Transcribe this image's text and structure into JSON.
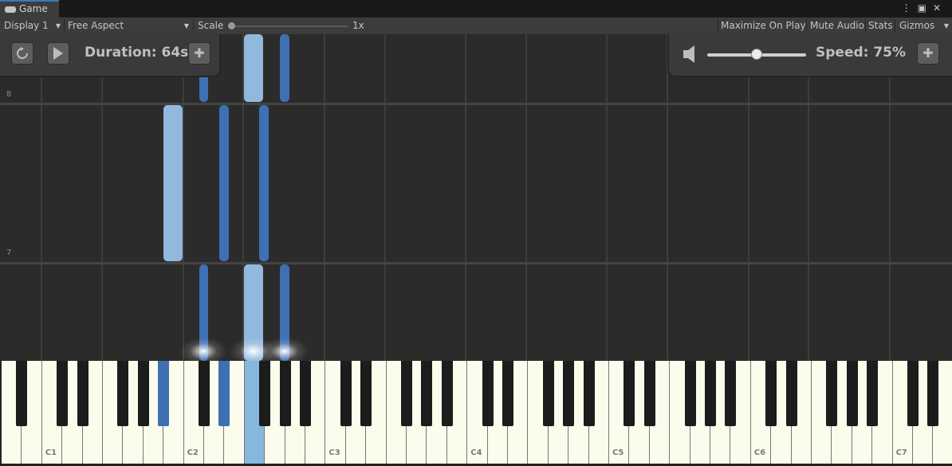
{
  "window": {
    "tab_title": "Game",
    "tab_icon": "gamepad-icon"
  },
  "toolbar": {
    "display": "Display 1",
    "aspect": "Free Aspect",
    "scale_label": "Scale",
    "scale_value": "1x",
    "maximize": "Maximize On Play",
    "mute": "Mute Audio",
    "stats": "Stats",
    "gizmos": "Gizmos"
  },
  "left_panel": {
    "duration": "Duration: 64s"
  },
  "right_panel": {
    "speed": "Speed: 75%",
    "volume_fraction": 0.5
  },
  "roll": {
    "measures": [
      "8",
      "7"
    ]
  },
  "keyboard": {
    "octave_labels": [
      "C1",
      "C2",
      "C3",
      "C4",
      "C5",
      "C6",
      "C7"
    ],
    "white_key_count": 47,
    "pressed_white_keys": [
      12
    ],
    "pressed_black_keys": [
      "A#1",
      "D#2"
    ]
  },
  "colors": {
    "note_dark": "#3e70b3",
    "note_light": "#92b8de",
    "accent": "#3a79bb"
  }
}
